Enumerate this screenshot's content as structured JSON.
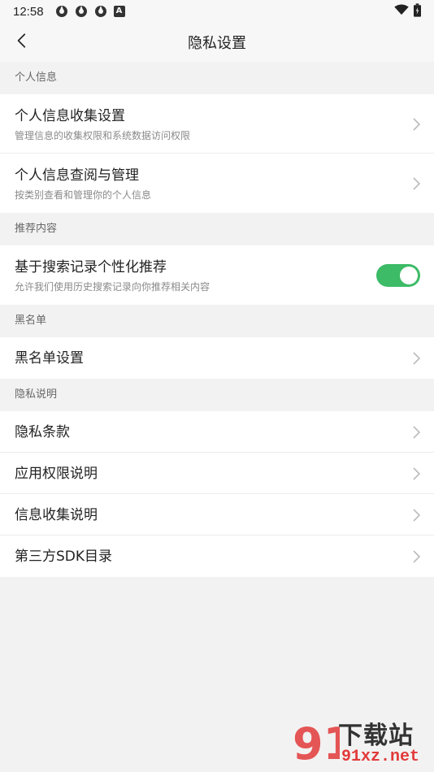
{
  "status_bar": {
    "time": "12:58",
    "notification_badge": "A"
  },
  "app_bar": {
    "title": "隐私设置"
  },
  "sections": [
    {
      "header": "个人信息",
      "items": [
        {
          "title": "个人信息收集设置",
          "subtitle": "管理信息的收集权限和系统数据访问权限"
        },
        {
          "title": "个人信息查阅与管理",
          "subtitle": "按类别查看和管理你的个人信息"
        }
      ]
    },
    {
      "header": "推荐内容",
      "items": [
        {
          "title": "基于搜索记录个性化推荐",
          "subtitle": "允许我们使用历史搜索记录向你推荐相关内容",
          "toggle": true
        }
      ]
    },
    {
      "header": "黑名单",
      "items": [
        {
          "title": "黑名单设置"
        }
      ]
    },
    {
      "header": "隐私说明",
      "items": [
        {
          "title": "隐私条款"
        },
        {
          "title": "应用权限说明"
        },
        {
          "title": "信息收集说明"
        },
        {
          "title": "第三方SDK目录"
        }
      ]
    }
  ],
  "colors": {
    "toggle_on": "#3dbb67",
    "background": "#f2f2f2"
  },
  "watermark": {
    "brand": "下载站",
    "url": "91xz.net"
  }
}
